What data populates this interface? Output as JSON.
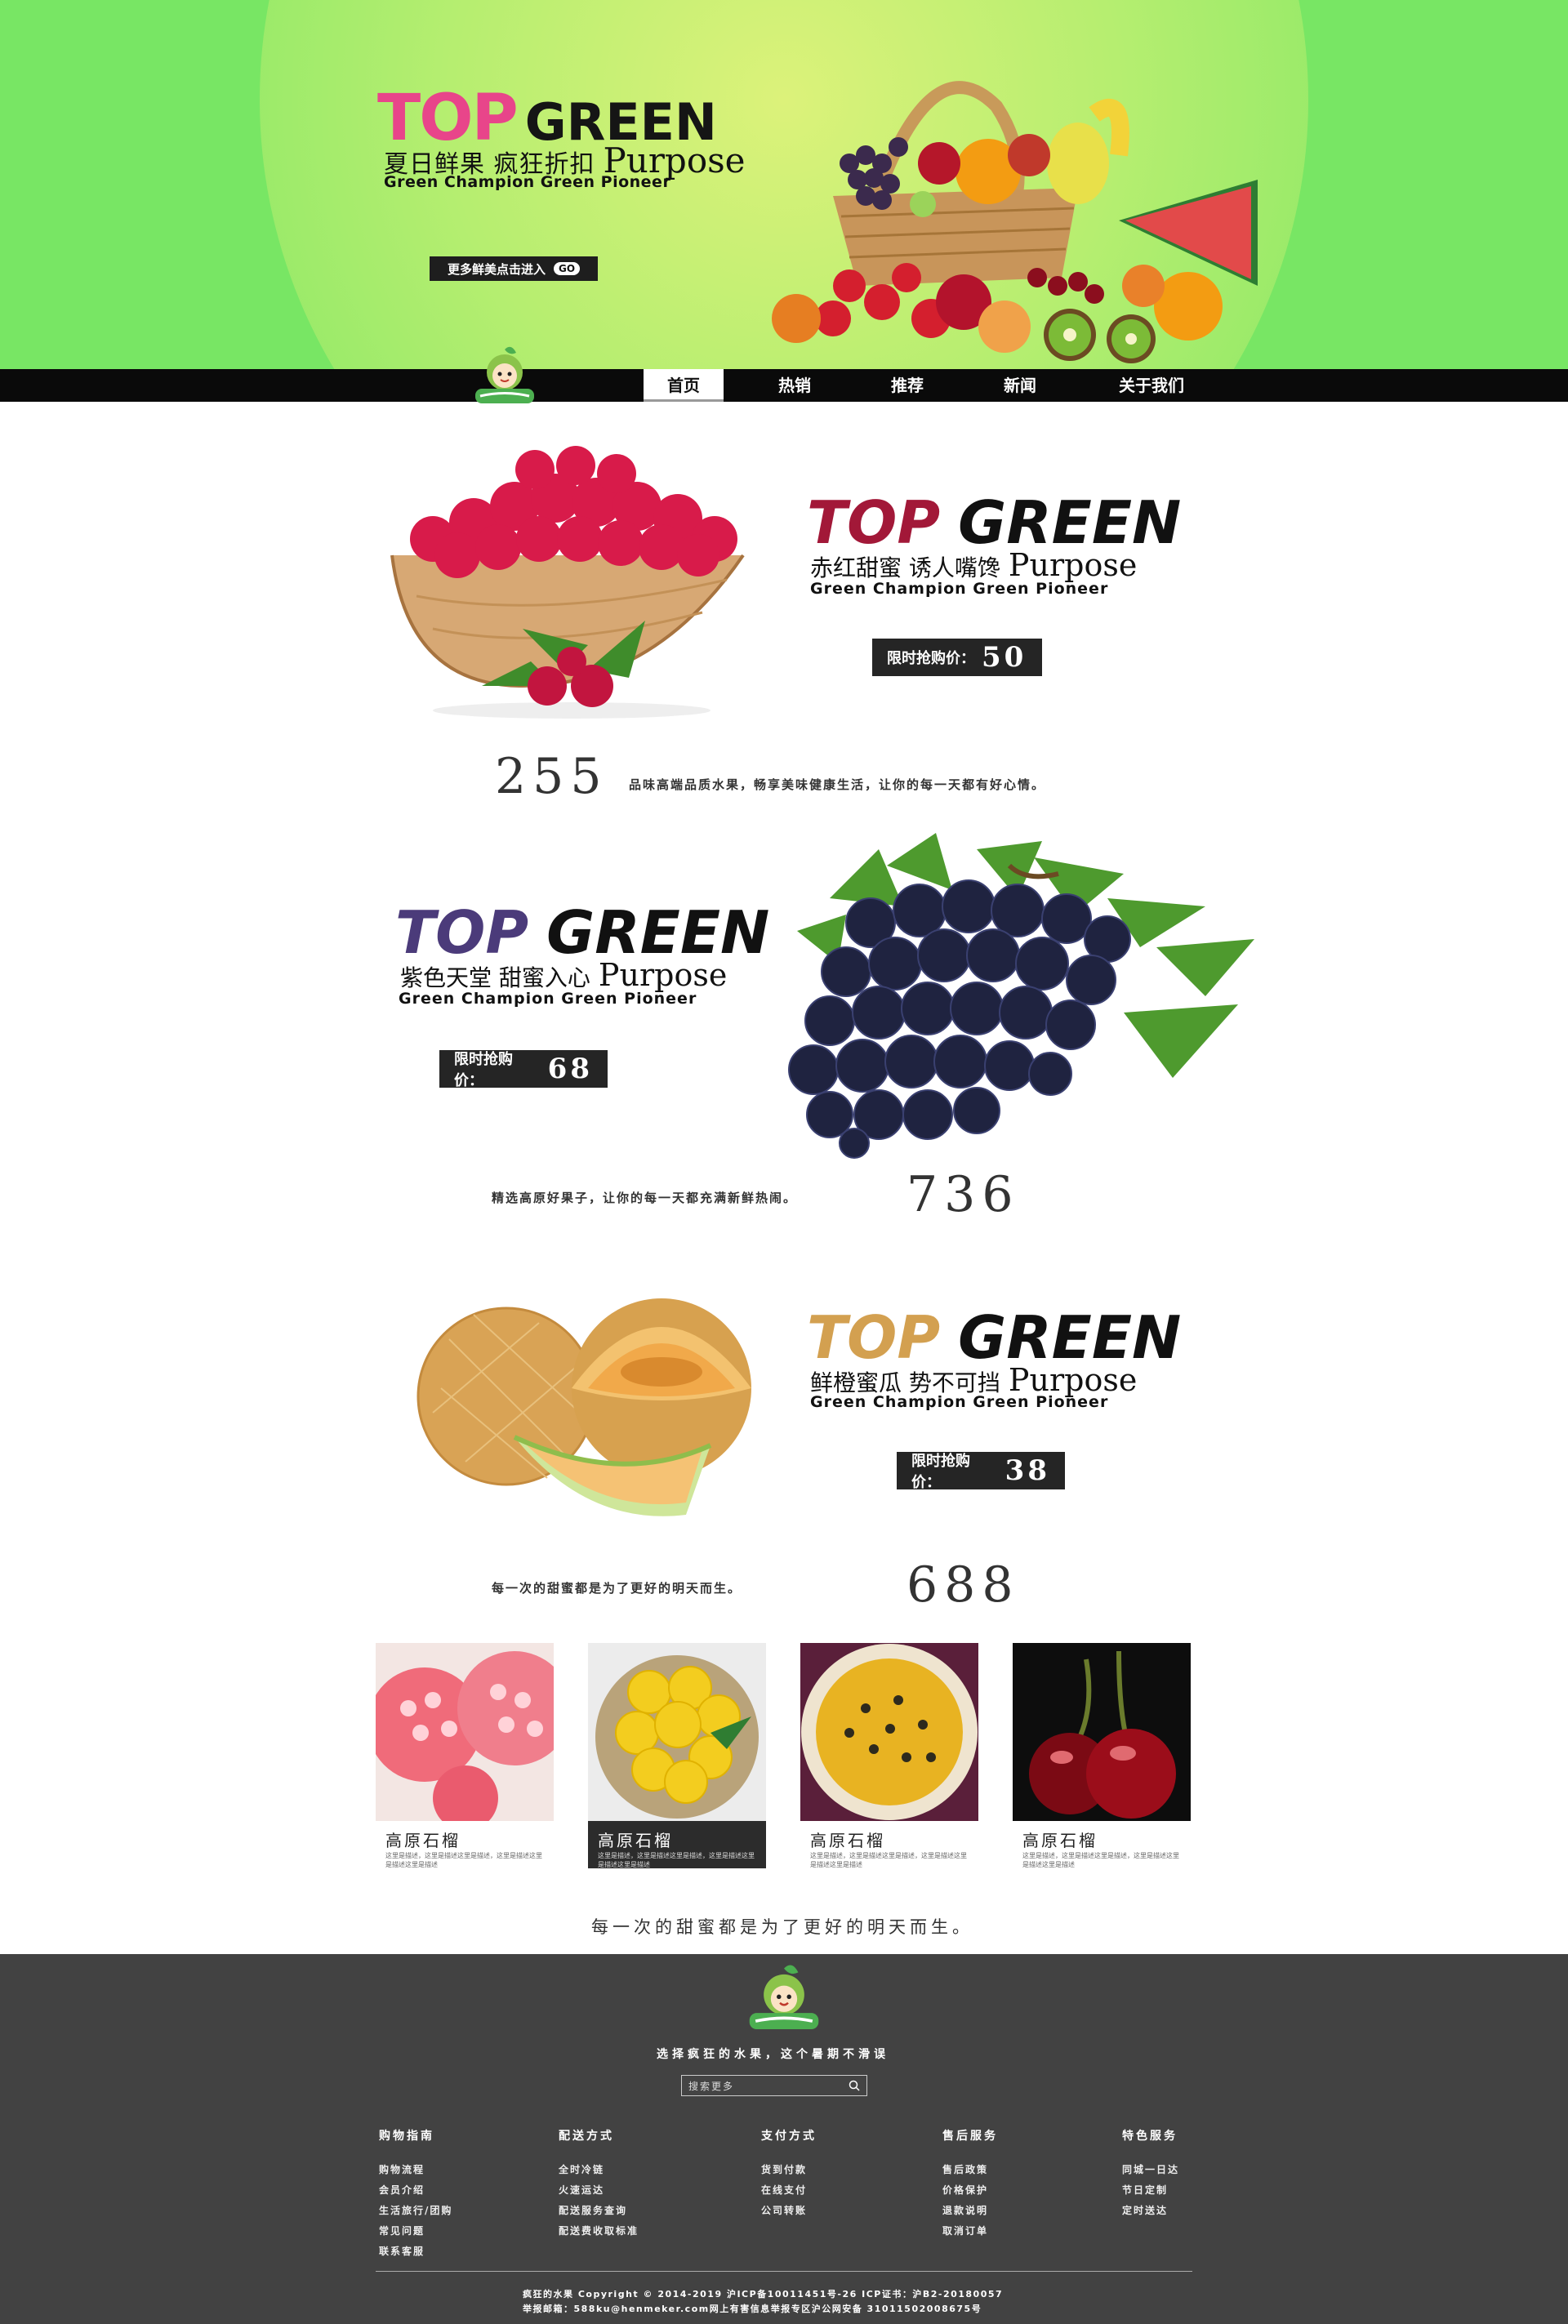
{
  "colors": {
    "hero_bg": "#78e664",
    "hero_top": "#e8458a",
    "raspberry_top": "#a21838",
    "grape_top": "#4b3b7a",
    "melon_top": "#d3a050",
    "nav_bg": "#0a0a0a",
    "footer_bg": "#424242"
  },
  "hero": {
    "title_top": "TOP",
    "title_green": "GREEN",
    "subtitle_cn": "夏日鲜果  疯狂折扣",
    "subtitle_en": "Purpose",
    "tagline": "Green Champion Green Pioneer",
    "cta_label": "更多鲜美点击进入",
    "cta_go": "GO",
    "image_icon": "fruit-basket-icon"
  },
  "nav": {
    "logo_icon": "fruit-mascot-logo",
    "items": [
      "首页",
      "热销",
      "推荐",
      "新闻",
      "关于我们"
    ]
  },
  "sections": [
    {
      "title_top": "TOP",
      "title_green": "GREEN",
      "subtitle_cn": "赤红甜蜜  诱人嘴馋",
      "subtitle_en": "Purpose",
      "tagline": "Green Champion Green Pioneer",
      "price_label": "限时抢购价：",
      "price": "50",
      "number": "255",
      "description": "品味高端品质水果，畅享美味健康生活，让你的每一天都有好心情。",
      "image_icon": "raspberry-bowl-icon"
    },
    {
      "title_top": "TOP",
      "title_green": "GREEN",
      "subtitle_cn": "紫色天堂  甜蜜入心",
      "subtitle_en": "Purpose",
      "tagline": "Green Champion Green Pioneer",
      "price_label": "限时抢购价：",
      "price": "68",
      "number": "736",
      "description": "精选高原好果子，让你的每一天都充满新鲜热闹。",
      "image_icon": "grapes-icon"
    },
    {
      "title_top": "TOP",
      "title_green": "GREEN",
      "subtitle_cn": "鲜橙蜜瓜  势不可挡",
      "subtitle_en": "Purpose",
      "tagline": "Green Champion Green Pioneer",
      "price_label": "限时抢购价：",
      "price": "38",
      "number": "688",
      "description": "每一次的甜蜜都是为了更好的明天而生。",
      "image_icon": "cantaloupe-icon"
    }
  ],
  "products": [
    {
      "name": "高原石榴",
      "desc": "这里是描述，这里是描述这里是描述，这里是描述这里是描述这里是描述",
      "image_icon": "pomegranate-icon"
    },
    {
      "name": "高原石榴",
      "desc": "这里是描述，这里是描述这里是描述，这里是描述这里是描述这里是描述",
      "image_icon": "lemons-icon"
    },
    {
      "name": "高原石榴",
      "desc": "这里是描述，这里是描述这里是描述，这里是描述这里是描述这里是描述",
      "image_icon": "passion-fruit-icon"
    },
    {
      "name": "高原石榴",
      "desc": "这里是描述，这里是描述这里是描述，这里是描述这里是描述这里是描述",
      "image_icon": "cherries-icon"
    }
  ],
  "closing_line": "每一次的甜蜜都是为了更好的明天而生。",
  "footer": {
    "logo_icon": "fruit-mascot-logo",
    "slogan": "选择疯狂的水果，这个暑期不滑误",
    "search_placeholder": "搜索更多",
    "columns": [
      {
        "heading": "购物指南",
        "links": [
          "购物流程",
          "会员介绍",
          "生活旅行/团购",
          "常见问题",
          "联系客服"
        ]
      },
      {
        "heading": "配送方式",
        "links": [
          "全时冷链",
          "火速运达",
          "配送服务查询",
          "配送费收取标准"
        ]
      },
      {
        "heading": "支付方式",
        "links": [
          "货到付款",
          "在线支付",
          "公司转账"
        ]
      },
      {
        "heading": "售后服务",
        "links": [
          "售后政策",
          "价格保护",
          "退款说明",
          "取消订单"
        ]
      },
      {
        "heading": "特色服务",
        "links": [
          "同城一日达",
          "节日定制",
          "定时送达"
        ]
      }
    ],
    "copyright_1": "疯狂的水果 Copyright © 2014-2019 沪ICP备10011451号-26      ICP证书：沪B2-20180057",
    "copyright_2": "举报邮箱：588ku@henmeker.com网上有害信息举报专区沪公网安备 31011502008675号"
  }
}
